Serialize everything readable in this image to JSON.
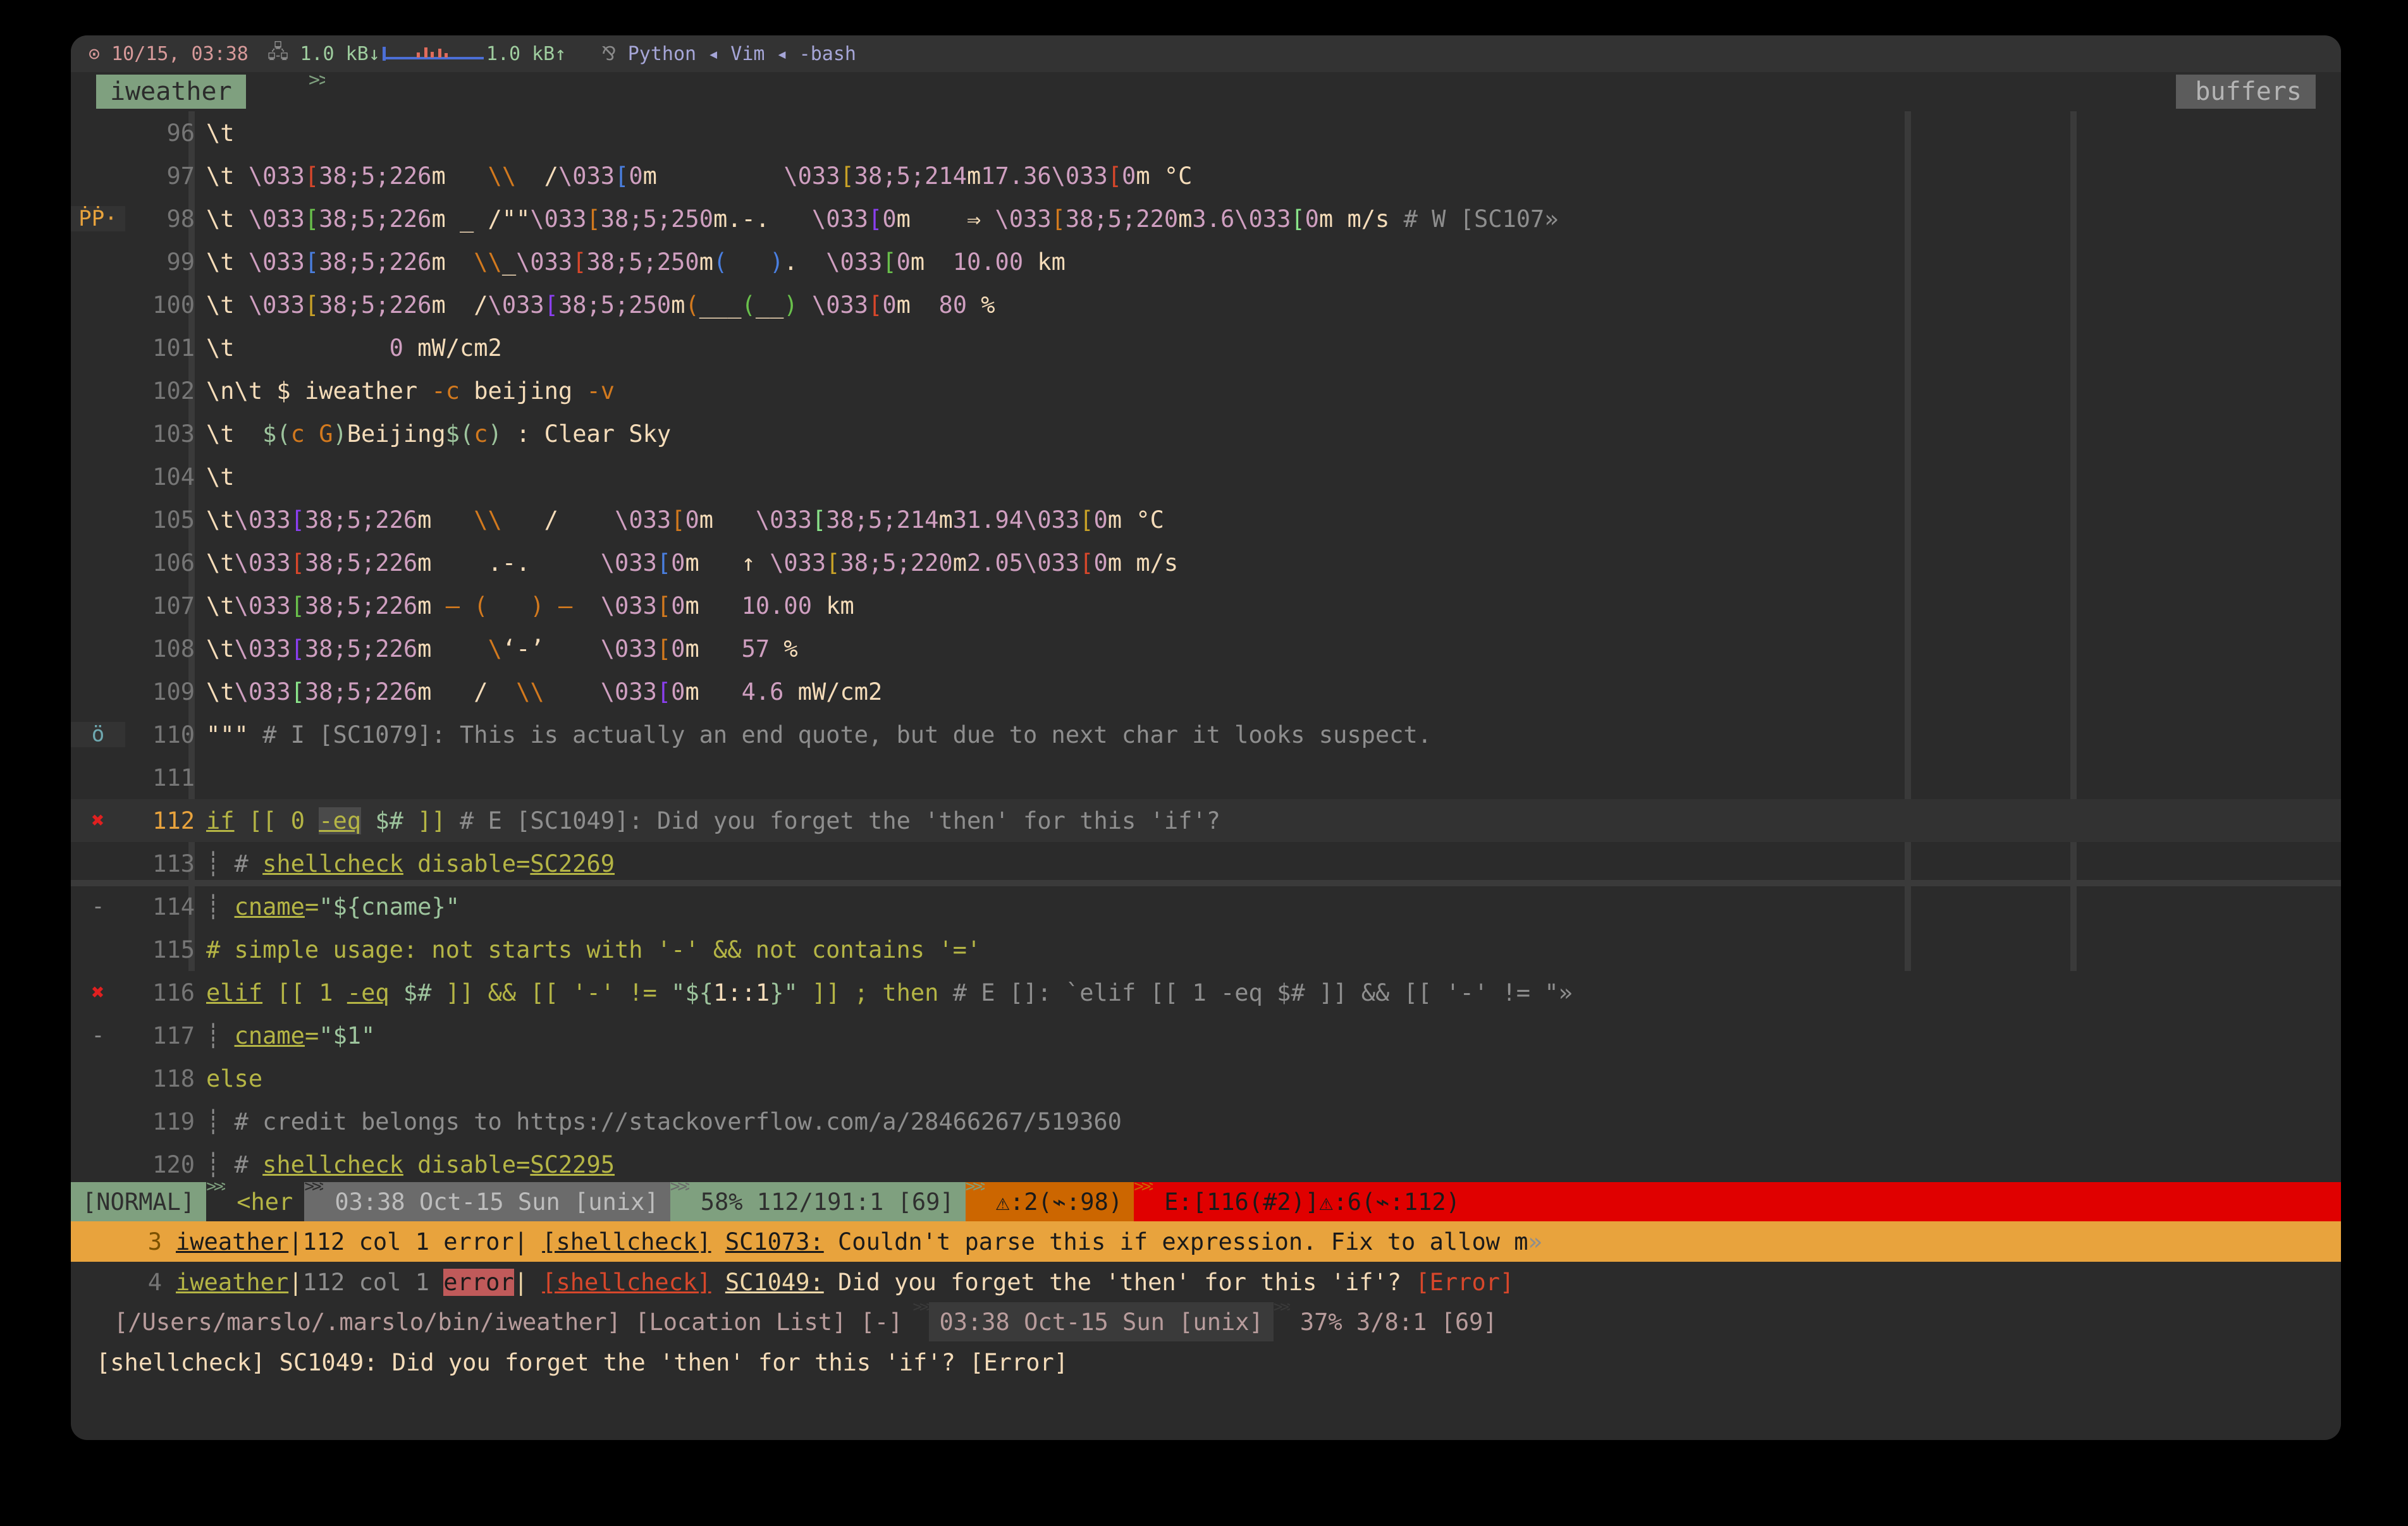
{
  "window": {
    "app": "vim",
    "shape": "rounded-dark-terminal"
  },
  "topbar": {
    "clock_icon": "clock-icon",
    "datetime": "10/15, 03:38",
    "net_icon": "network-icon",
    "download": "1.0 kB↓",
    "upload": "1.0 kB↑",
    "proc_icon": "process-tree-icon",
    "processes": "Python ◂ Vim ◂ -bash"
  },
  "tabline": {
    "active_tab": "iweather",
    "right_label": "buffers"
  },
  "editor": {
    "lines": [
      {
        "num": "96",
        "sign": "",
        "cursor": false
      },
      {
        "num": "97",
        "sign": "",
        "cursor": false
      },
      {
        "num": "98",
        "sign": "ṖṖ·",
        "sign_kind": "warning-sign",
        "cursor": false
      },
      {
        "num": "99",
        "sign": "",
        "cursor": false
      },
      {
        "num": "100",
        "sign": "",
        "cursor": false
      },
      {
        "num": "101",
        "sign": "",
        "cursor": false
      },
      {
        "num": "102",
        "sign": "",
        "cursor": false
      },
      {
        "num": "103",
        "sign": "",
        "cursor": false
      },
      {
        "num": "104",
        "sign": "",
        "cursor": false
      },
      {
        "num": "105",
        "sign": "",
        "cursor": false
      },
      {
        "num": "106",
        "sign": "",
        "cursor": false
      },
      {
        "num": "107",
        "sign": "",
        "cursor": false
      },
      {
        "num": "108",
        "sign": "",
        "cursor": false
      },
      {
        "num": "109",
        "sign": "",
        "cursor": false
      },
      {
        "num": "110",
        "sign": "ö",
        "sign_kind": "info-sign",
        "cursor": false
      },
      {
        "num": "111",
        "sign": "",
        "cursor": false
      },
      {
        "num": "112",
        "sign": "✖",
        "sign_kind": "error-sign",
        "cursor": true
      },
      {
        "num": "113",
        "sign": "",
        "cursor": false
      },
      {
        "num": "114",
        "sign": "-",
        "sign_kind": "diff-change-sign",
        "cursor": false
      },
      {
        "num": "115",
        "sign": "",
        "cursor": false
      },
      {
        "num": "116",
        "sign": "✖",
        "sign_kind": "error-sign",
        "cursor": false
      },
      {
        "num": "117",
        "sign": "-",
        "sign_kind": "diff-change-sign",
        "cursor": false
      },
      {
        "num": "118",
        "sign": "",
        "cursor": false
      },
      {
        "num": "119",
        "sign": "",
        "cursor": false
      },
      {
        "num": "120",
        "sign": "",
        "cursor": false
      }
    ],
    "text": {
      "l96": "\\t",
      "l97": "\\t \\033[38;5;226m    \\\\   /\\033[0m          \\033[38;5;214m17.36\\033[0m °C",
      "l98": "\\t \\033[38;5;226m _ /\"\"\\033[38;5;250m.-.    \\033[0m    ⇒ \\033[38;5;220m3.6\\033[0m m/s # W [SC107",
      "l99": "\\t \\033[38;5;226m   \\\\_\\033[38;5;250m(   ).  \\033[0m  10.00 km",
      "l100": "\\t \\033[38;5;226m   /\\033[38;5;250m(___(__) \\033[0m  80 %",
      "l101": "\\t             0 mW/cm2",
      "l102": "\\n\\t $ iweather -c beijing -v",
      "l103": "\\t  $(c G)Beijing$(c) : Clear Sky",
      "l104": "\\t",
      "l105": "\\t\\033[38;5;226m    \\\\\\\\   /    \\033[0m   \\033[38;5;214m31.94\\033[0m °C",
      "l106": "\\t\\033[38;5;226m     .-.     \\033[0m   ↑ \\033[38;5;220m2.05\\033[0m m/s",
      "l107": "\\t\\033[38;5;226m  – (   ) –  \\033[0m   10.00 km",
      "l108": "\\t\\033[38;5;226m     \\\\`-’     \\033[0m   57 %",
      "l109": "\\t\\033[38;5;226m    /   \\\\\\\\    \\033[0m   4.6 mW/cm2",
      "l110": "\"\"\" # I [SC1079]: This is actually an end quote, but due to next char it looks suspect.",
      "l111": "",
      "l112": "if [[ 0 -eq $# ]] # E [SC1049]: Did you forget the 'then' for this 'if'?",
      "l113": "  # shellcheck disable=SC2269",
      "l114": "  cname=\"${cname}\"",
      "l115": "# simple usage: not starts with '-' && not contains '='",
      "l116": "elif [[ 1 -eq $# ]] && [[ '-' != \"${1::1}\" ]] ; then # E []: `elif [[ 1 -eq $# ]] && [[ '-' != \"",
      "l117": "  cname=\"$1\"",
      "l118": "else",
      "l119": "  # credit belongs to https://stackoverflow.com/a/28466267/519360",
      "l120": "  # shellcheck disable=SC2295"
    }
  },
  "statusline": {
    "mode": "[NORMAL]",
    "branch": "<her",
    "datetime": "03:38 Oct-15 Sun [unix]",
    "position": "58% 112/191:1 [69]",
    "warnings": "⚠:2(⌁:98)",
    "errors": "E:[116(#2)]⚠:6(⌁:112)"
  },
  "loclist": {
    "rows": [
      {
        "index": "3",
        "file": "iweather",
        "position": "112 col 1 ",
        "severity": "error",
        "tool": "[shellcheck]",
        "code": "SC1073:",
        "message": " Couldn't parse this if expression. Fix to allow m",
        "tail": "",
        "selected": true
      },
      {
        "index": "4",
        "file": "iweather",
        "position": "112 col 1 ",
        "severity": "error",
        "tool": "[shellcheck]",
        "code": "SC1049:",
        "message": " Did you forget the 'then' for this 'if'? ",
        "tail": "[Error]",
        "selected": false
      }
    ]
  },
  "botstatus": {
    "path": "[/Users/marslo/.marslo/bin/iweather] [Location List] [-]",
    "datetime": "03:38 Oct-15 Sun [unix]",
    "position": "37% 3/8:1 [69]"
  },
  "message": "[shellcheck] SC1049: Did you forget the 'then' for this 'if'? [Error]",
  "colors": {
    "bg": "#2b2b2b",
    "accent_green": "#7fa07f",
    "accent_orange": "#e8a33d",
    "accent_warn": "#cc6600",
    "accent_error": "#e00000",
    "fg": "#f5dcb9"
  }
}
